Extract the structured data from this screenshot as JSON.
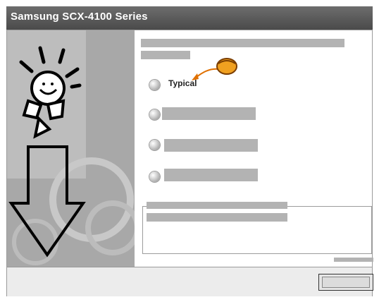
{
  "window": {
    "title": "Samsung SCX-4100 Series"
  },
  "options": [
    {
      "label": "Typical",
      "selected": false
    }
  ],
  "colors": {
    "titlebar": "#575757",
    "accent": "#e07000",
    "art_bg": "#a8a8a8"
  }
}
